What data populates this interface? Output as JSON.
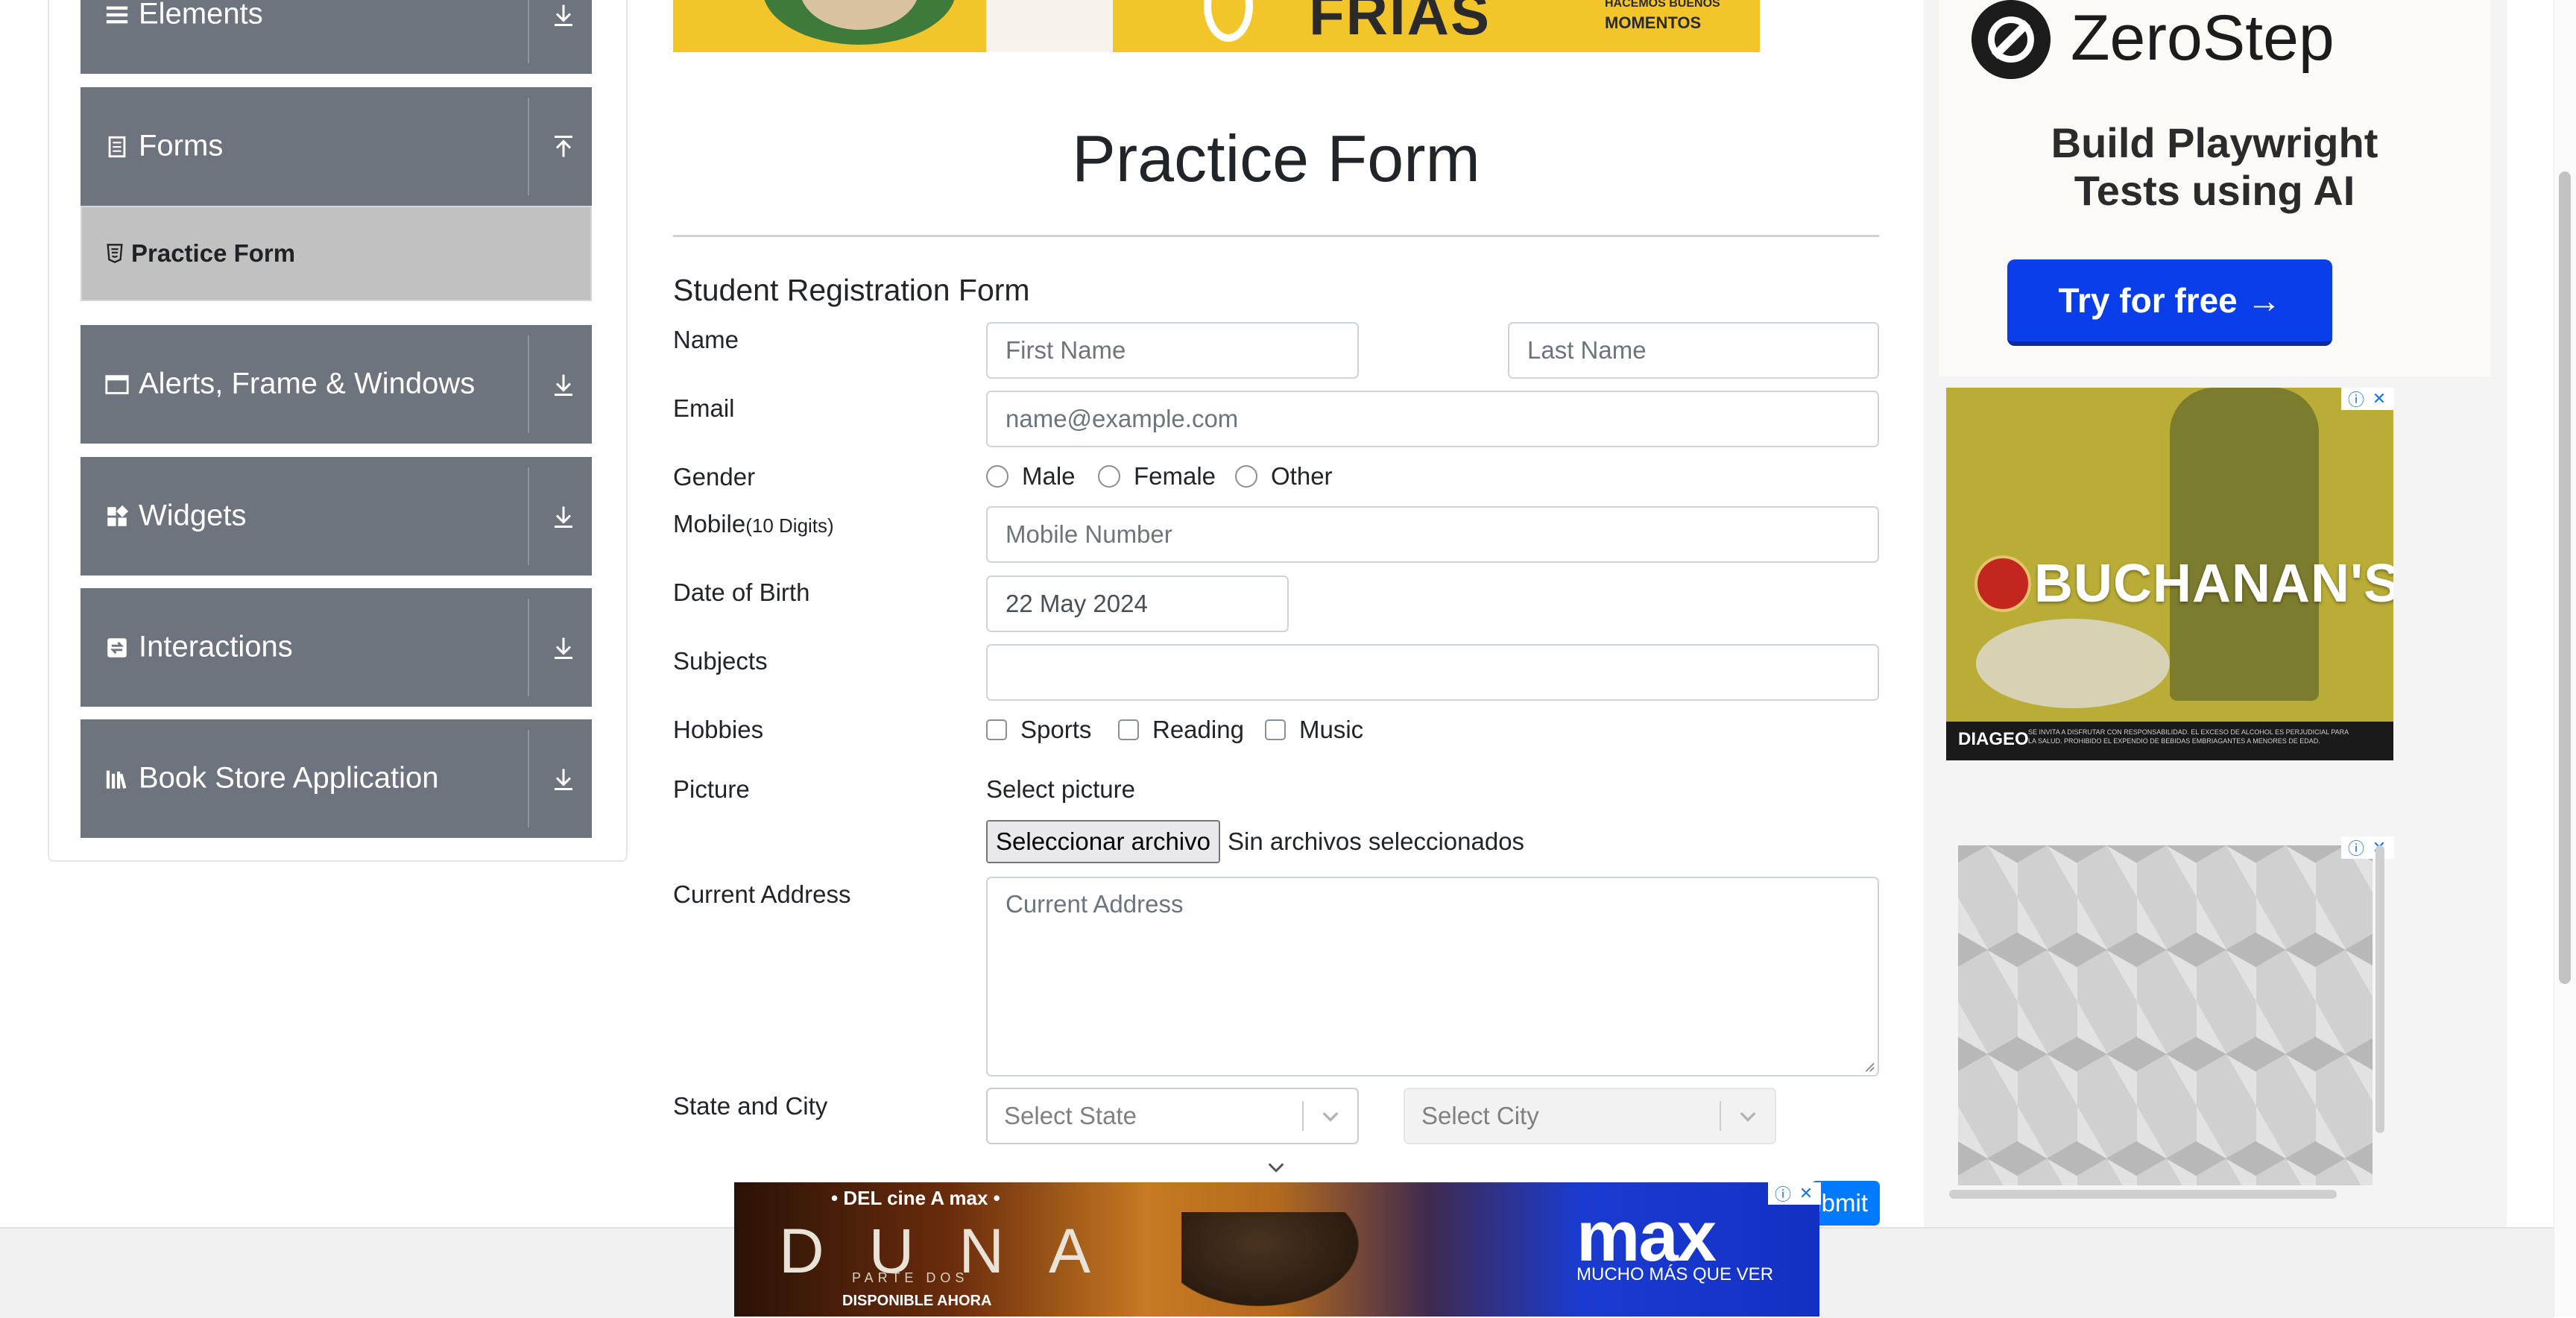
{
  "sidebar": {
    "groups": [
      {
        "label": "Elements",
        "icon": "list-icon"
      },
      {
        "label": "Forms",
        "icon": "document-icon",
        "sub_items": [
          {
            "label": "Practice Form",
            "icon": "html5-icon",
            "active": true
          }
        ]
      },
      {
        "label": "Alerts, Frame & Windows",
        "icon": "window-icon"
      },
      {
        "label": "Widgets",
        "icon": "widgets-icon"
      },
      {
        "label": "Interactions",
        "icon": "interactions-icon"
      },
      {
        "label": "Book Store Application",
        "icon": "books-icon"
      }
    ]
  },
  "banner": {
    "word": "FRIAS",
    "tagline_1": "HACEMOS BUENOS",
    "tagline_2": "MOMENTOS"
  },
  "page": {
    "title": "Practice Form"
  },
  "form": {
    "heading": "Student Registration Form",
    "name_label": "Name",
    "first_name_placeholder": "First Name",
    "last_name_placeholder": "Last Name",
    "email_label": "Email",
    "email_placeholder": "name@example.com",
    "gender_label": "Gender",
    "gender_options": [
      "Male",
      "Female",
      "Other"
    ],
    "mobile_label": "Mobile",
    "mobile_hint": "(10 Digits)",
    "mobile_placeholder": "Mobile Number",
    "dob_label": "Date of Birth",
    "dob_value": "22 May 2024",
    "subjects_label": "Subjects",
    "subjects_value": "",
    "hobbies_label": "Hobbies",
    "hobbies_options": [
      "Sports",
      "Reading",
      "Music"
    ],
    "picture_label": "Picture",
    "picture_caption": "Select picture",
    "file_button": "Seleccionar archivo",
    "file_status": "Sin archivos seleccionados",
    "address_label": "Current Address",
    "address_placeholder": "Current Address",
    "state_city_label": "State and City",
    "state_placeholder": "Select State",
    "city_placeholder": "Select City",
    "submit_label": "Submit"
  },
  "ads": {
    "zerostep": {
      "name": "ZeroStep",
      "line1": "Build Playwright",
      "line2": "Tests using AI",
      "button": "Try for free →"
    },
    "buchanans": {
      "brand": "BUCHANAN'S",
      "footer_brand": "DIAGEO",
      "legal": "SE INVITA A DISFRUTAR CON RESPONSABILIDAD. EL EXCESO DE ALCOHOL ES PERJUDICIAL PARA LA SALUD. PROHIBIDO EL EXPENDIO DE BEBIDAS EMBRIAGANTES A MENORES DE EDAD."
    },
    "info_glyph": "ⓘ",
    "close_glyph": "✕",
    "max": {
      "tag": "• DEL cine A max •",
      "title": "DUNA",
      "subtitle": "PARTE DOS",
      "availability": "DISPONIBLE AHORA",
      "brand": "max",
      "slogan": "MUCHO MÁS QUE VER"
    }
  },
  "colors": {
    "sidebar_group": "#6d747d",
    "sidebar_active": "#c1c1c1",
    "submit": "#007bff",
    "zerostep_button": "#0a3ee8"
  }
}
